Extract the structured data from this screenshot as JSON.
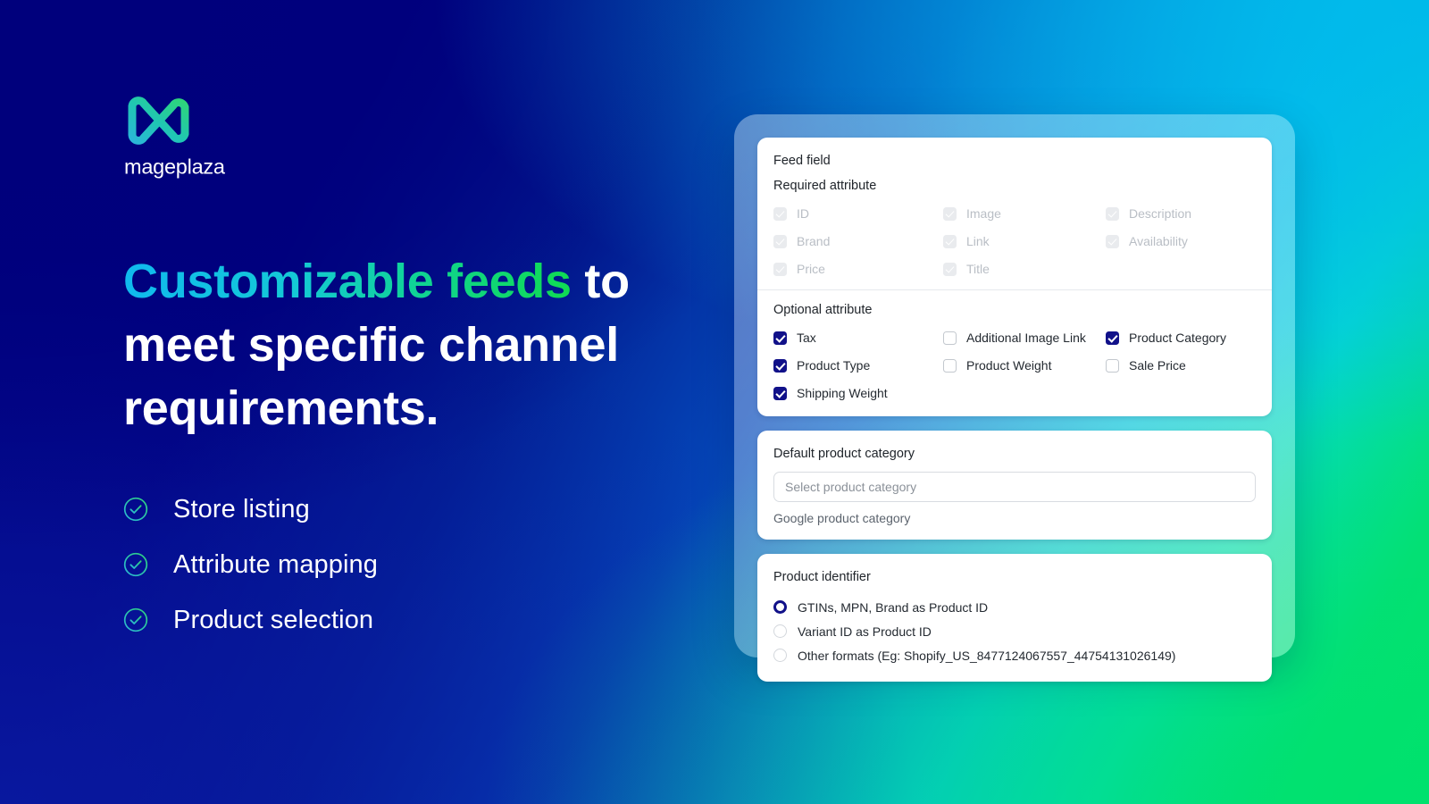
{
  "brand": {
    "name": "mageplaza",
    "logo_icon": "mageplaza-m-logo-icon"
  },
  "hero": {
    "headline_highlight": "Customizable feeds",
    "headline_rest": " to meet specific channel requirements.",
    "bullets": [
      {
        "label": "Store listing",
        "icon": "check-circle-icon"
      },
      {
        "label": "Attribute mapping",
        "icon": "check-circle-icon"
      },
      {
        "label": "Product selection",
        "icon": "check-circle-icon"
      }
    ]
  },
  "colors": {
    "accent_cyan": "#00bfe8",
    "accent_green": "#03e463",
    "deep_navy": "#00007f",
    "checkbox_checked": "#111189",
    "radio_selected": "#111189"
  },
  "panel": {
    "feed_field_card": {
      "title": "Feed field",
      "required_section_label": "Required attribute",
      "required_attributes": [
        {
          "label": "ID",
          "checked": true,
          "disabled": true
        },
        {
          "label": "Image",
          "checked": true,
          "disabled": true
        },
        {
          "label": "Description",
          "checked": true,
          "disabled": true
        },
        {
          "label": "Brand",
          "checked": true,
          "disabled": true
        },
        {
          "label": "Link",
          "checked": true,
          "disabled": true
        },
        {
          "label": "Availability",
          "checked": true,
          "disabled": true
        },
        {
          "label": "Price",
          "checked": true,
          "disabled": true
        },
        {
          "label": "Title",
          "checked": true,
          "disabled": true
        }
      ],
      "optional_section_label": "Optional attribute",
      "optional_attributes": [
        {
          "label": "Tax",
          "checked": true
        },
        {
          "label": "Additional Image Link",
          "checked": false
        },
        {
          "label": "Product Category",
          "checked": true
        },
        {
          "label": "Product Type",
          "checked": true
        },
        {
          "label": "Product Weight",
          "checked": false
        },
        {
          "label": "Sale Price",
          "checked": false
        },
        {
          "label": "Shipping Weight",
          "checked": true
        }
      ]
    },
    "default_category_card": {
      "title": "Default product category",
      "select_placeholder": "Select product category",
      "select_value": "",
      "helper_text": "Google product category"
    },
    "product_identifier_card": {
      "title": "Product identifier",
      "options": [
        {
          "label": "GTINs, MPN, Brand as Product ID",
          "selected": true
        },
        {
          "label": "Variant ID as Product ID",
          "selected": false
        },
        {
          "label": "Other formats (Eg: Shopify_US_8477124067557_44754131026149)",
          "selected": false
        }
      ]
    }
  }
}
